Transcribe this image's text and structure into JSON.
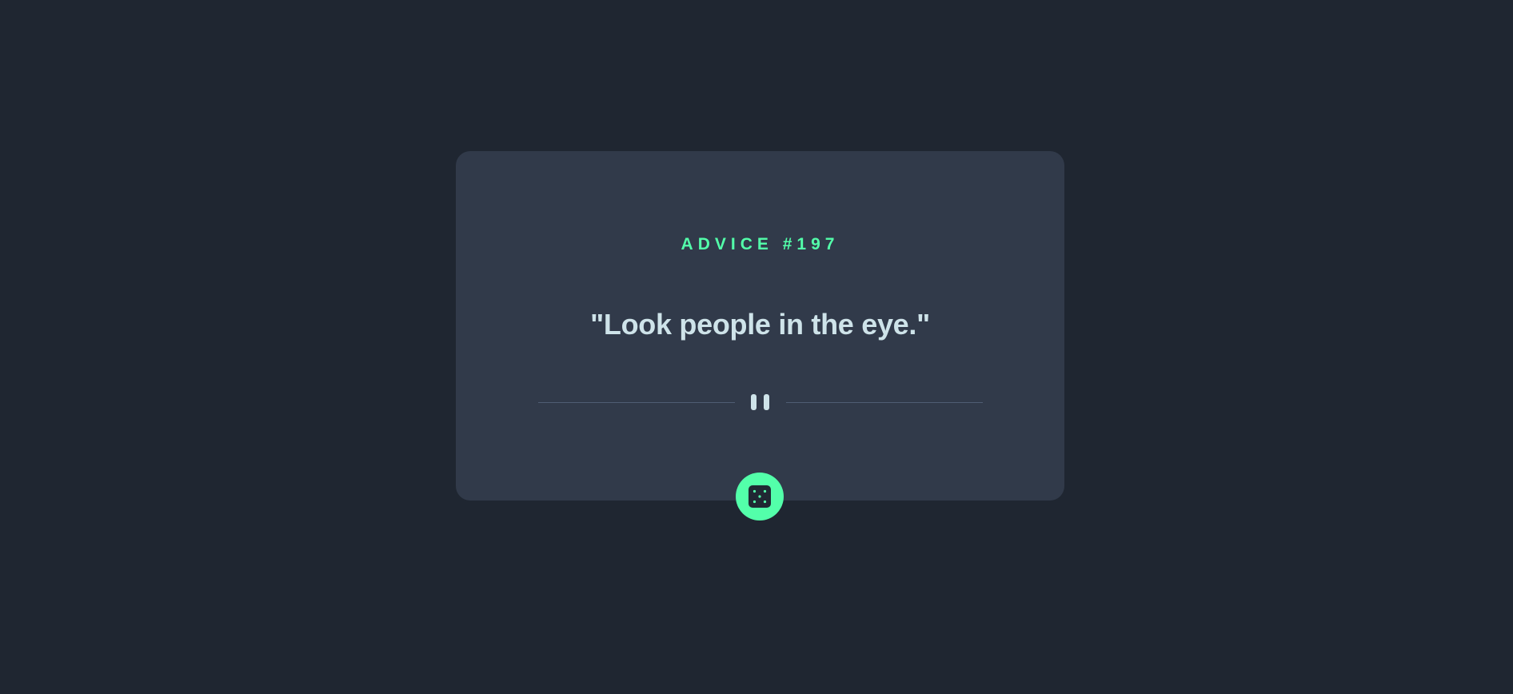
{
  "card": {
    "advice_label": "ADVICE #197",
    "advice_text": "\"Look people in the eye.\""
  },
  "divider": {
    "icon": "pause-quote-icon"
  },
  "button": {
    "icon": "dice-icon",
    "aria_label": "Get new advice"
  },
  "colors": {
    "background": "#1f2631",
    "card": "#313a4a",
    "accent": "#53ffaa",
    "text": "#cee3e9",
    "divider": "#4f5d74"
  }
}
